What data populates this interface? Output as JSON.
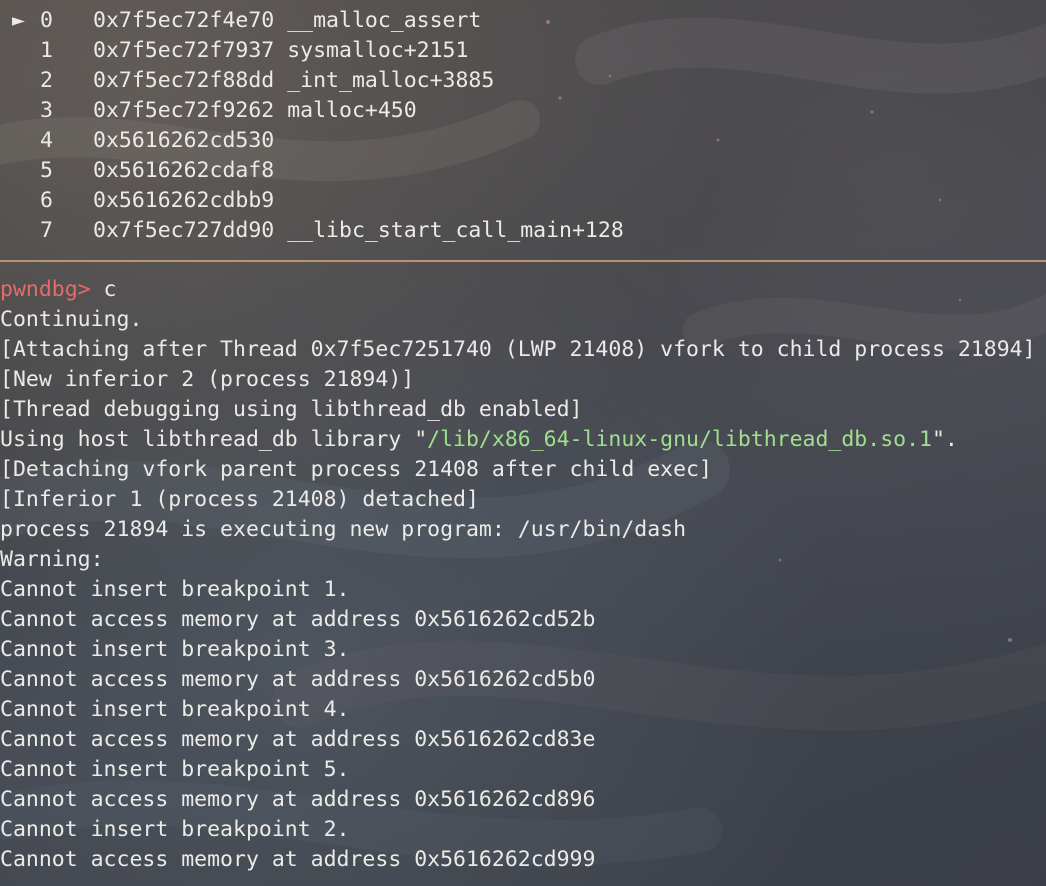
{
  "backtrace": [
    {
      "marker": "►",
      "index": "0",
      "address": "0x7f5ec72f4e70",
      "symbol": "__malloc_assert"
    },
    {
      "marker": "",
      "index": "1",
      "address": "0x7f5ec72f7937",
      "symbol": "sysmalloc+2151"
    },
    {
      "marker": "",
      "index": "2",
      "address": "0x7f5ec72f88dd",
      "symbol": "_int_malloc+3885"
    },
    {
      "marker": "",
      "index": "3",
      "address": "0x7f5ec72f9262",
      "symbol": "malloc+450"
    },
    {
      "marker": "",
      "index": "4",
      "address": "0x5616262cd530",
      "symbol": ""
    },
    {
      "marker": "",
      "index": "5",
      "address": "0x5616262cdaf8",
      "symbol": ""
    },
    {
      "marker": "",
      "index": "6",
      "address": "0x5616262cdbb9",
      "symbol": ""
    },
    {
      "marker": "",
      "index": "7",
      "address": "0x7f5ec727dd90",
      "symbol": "__libc_start_call_main+128"
    }
  ],
  "prompt": {
    "label": "pwndbg>",
    "command": " c"
  },
  "host_lib_line": {
    "prefix": "Using host libthread_db library \"",
    "path": "/lib/x86_64-linux-gnu/libthread_db.so.1",
    "suffix": "\"."
  },
  "output_before": [
    "Continuing.",
    "[Attaching after Thread 0x7f5ec7251740 (LWP 21408) vfork to child process 21894]",
    "[New inferior 2 (process 21894)]",
    "[Thread debugging using libthread_db enabled]"
  ],
  "output_after": [
    "[Detaching vfork parent process 21408 after child exec]",
    "[Inferior 1 (process 21408) detached]",
    "process 21894 is executing new program: /usr/bin/dash",
    "Warning:",
    "Cannot insert breakpoint 1.",
    "Cannot access memory at address 0x5616262cd52b",
    "Cannot insert breakpoint 3.",
    "Cannot access memory at address 0x5616262cd5b0",
    "Cannot insert breakpoint 4.",
    "Cannot access memory at address 0x5616262cd83e",
    "Cannot insert breakpoint 5.",
    "Cannot access memory at address 0x5616262cd896",
    "Cannot insert breakpoint 2.",
    "Cannot access memory at address 0x5616262cd999"
  ],
  "colors": {
    "prompt": "#e36b6b",
    "path": "#9fe08e",
    "separator": "#c59a73",
    "text": "#eceae7"
  }
}
